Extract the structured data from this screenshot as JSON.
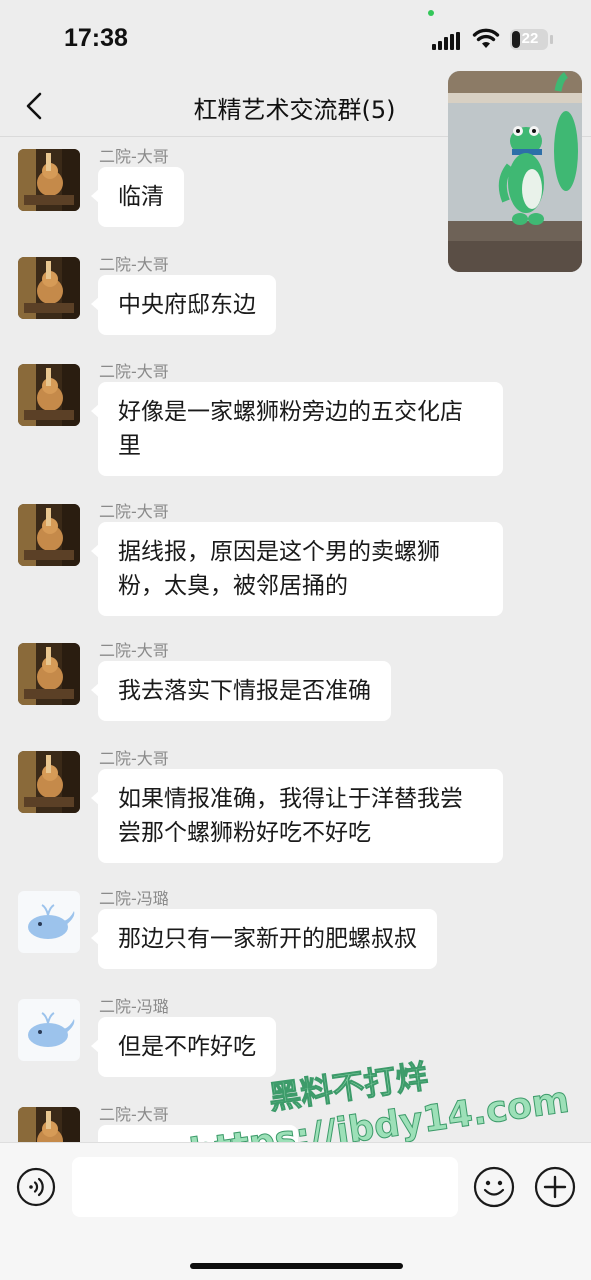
{
  "status_bar": {
    "time": "17:38",
    "battery_level": "22",
    "icons": [
      "signal-icon",
      "wifi-icon",
      "battery-icon"
    ]
  },
  "nav": {
    "title": "杠精艺术交流群(5)",
    "back_icon": "chevron-left-icon"
  },
  "messages": [
    {
      "sender": "二院-大哥",
      "avatar": "cat-avatar",
      "text": "临清"
    },
    {
      "sender": "二院-大哥",
      "avatar": "cat-avatar",
      "text": "中央府邸东边"
    },
    {
      "sender": "二院-大哥",
      "avatar": "cat-avatar",
      "text": "好像是一家螺狮粉旁边的五交化店里"
    },
    {
      "sender": "二院-大哥",
      "avatar": "cat-avatar",
      "text": "据线报，原因是这个男的卖螺狮粉，太臭，被邻居捅的"
    },
    {
      "sender": "二院-大哥",
      "avatar": "cat-avatar",
      "text": "我去落实下情报是否准确"
    },
    {
      "sender": "二院-大哥",
      "avatar": "cat-avatar",
      "text": "如果情报准确，我得让于洋替我尝尝那个螺狮粉好吃不好吃"
    },
    {
      "sender": "二院-冯璐",
      "avatar": "whale-avatar",
      "text": "那边只有一家新开的肥螺叔叔"
    },
    {
      "sender": "二院-冯璐",
      "avatar": "whale-avatar",
      "text": "但是不咋好吃"
    },
    {
      "sender": "二院-大哥",
      "avatar": "cat-avatar",
      "text": ""
    }
  ],
  "input_bar": {
    "voice_icon": "voice-icon",
    "emoji_icon": "emoji-icon",
    "plus_icon": "plus-icon",
    "input_value": ""
  },
  "watermark": {
    "line1": "黑料不打烊",
    "line2": "https://ibdy14.com"
  },
  "colors": {
    "background": "#ededed",
    "bubble": "#ffffff",
    "sender_text": "#8a8a8a",
    "watermark": "#9de0b8"
  }
}
